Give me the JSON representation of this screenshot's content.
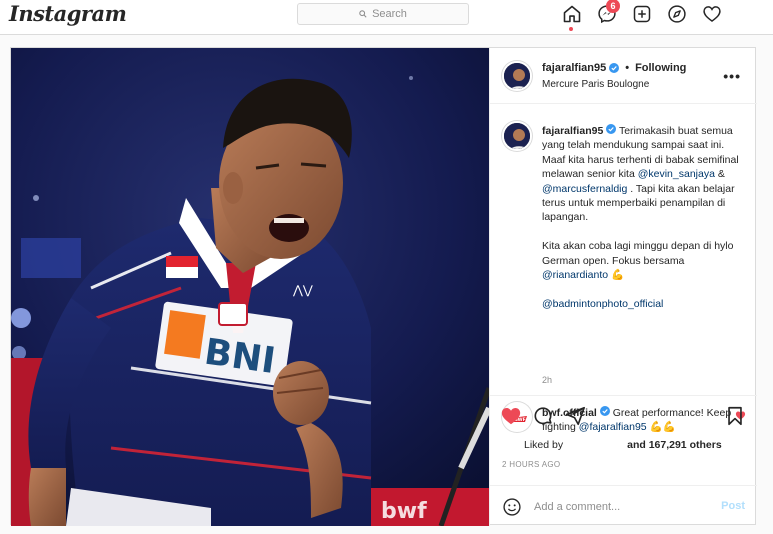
{
  "app": {
    "logo": "Instagram"
  },
  "search": {
    "placeholder": "Search"
  },
  "nav": {
    "messages_badge": "6",
    "icons": [
      "home-icon",
      "messenger-icon",
      "new-post-icon",
      "explore-icon",
      "activity-heart-icon"
    ]
  },
  "post": {
    "author": "fajaralfian95",
    "follow_status": "Following",
    "location": "Mercure Paris Boulogne",
    "caption": {
      "username": "fajaralfian95",
      "line1_a": "Terimakasih buat semua yang telah mendukung sampai saat ini. Maaf kita harus terhenti di babak semifinal melawan senior kita ",
      "mention1": "@kevin_sanjaya",
      "amp": " & ",
      "mention2": "@marcusfernaldig",
      "line1_b": " . Tapi kita akan belajar terus untuk memperbaiki penampilan di lapangan.",
      "line2_a": "Kita akan coba lagi minggu depan di hylo German open. Fokus bersama ",
      "mention3": "@rianardianto",
      "line2_emoji": "💪",
      "mention4": "@badmintonphoto_official",
      "time": "2h"
    },
    "comment": {
      "username": "bwf.official",
      "text_a": "Great performance! Keep fighting ",
      "mention": "@fajaralfian95",
      "emoji": "💪💪"
    },
    "likes": {
      "liked_by_prefix": "Liked by",
      "and_others": "and 167,291 others"
    },
    "posted_ago": "2 HOURS AGO",
    "add_comment_placeholder": "Add a comment...",
    "post_button": "Post",
    "jersey_sponsor": "BNI"
  },
  "colors": {
    "accent_red": "#ed4956",
    "link_blue": "#00376b",
    "verified_blue": "#3897f0",
    "post_button_disabled": "#b2dffc"
  }
}
